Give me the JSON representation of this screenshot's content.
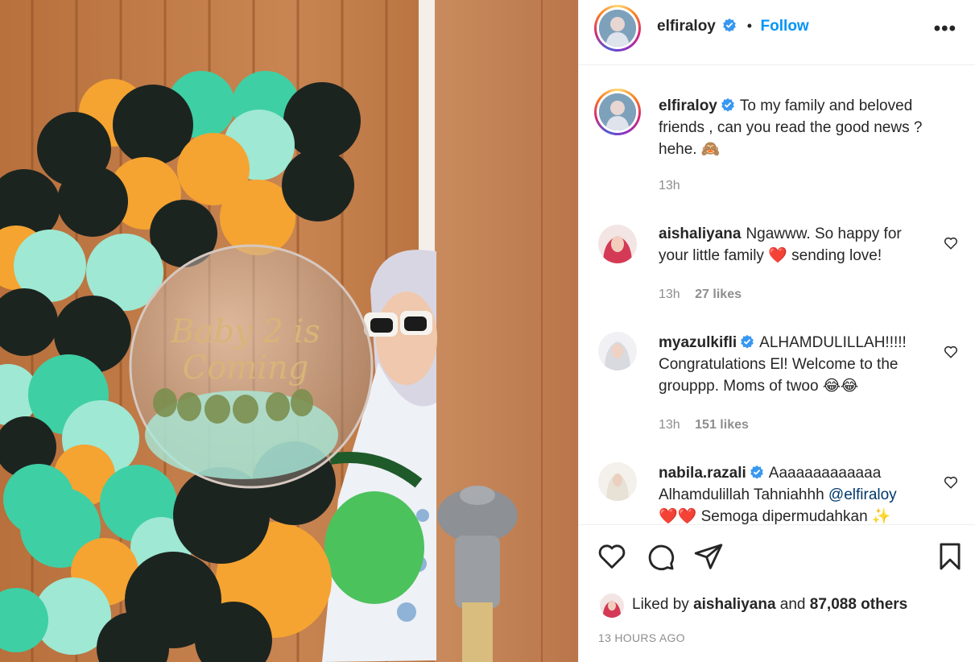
{
  "post": {
    "header": {
      "username": "elfiraloy",
      "follow_label": "Follow",
      "separator": "•",
      "more_label": "•••"
    },
    "caption": {
      "username": "elfiraloy",
      "text": "To my family and beloved friends , can you read the good news ? hehe.",
      "emoji": "🙈",
      "time": "13h"
    },
    "comments": [
      {
        "username": "aishaliyana",
        "text_before": "Ngawww. So happy for your little family",
        "emoji": "❤️",
        "text_after": "sending love!",
        "time": "13h",
        "likes": "27 likes"
      },
      {
        "username": "myazulkifli",
        "text": "ALHAMDULILLAH!!!!! Congratulations El! Welcome to the grouppp. Moms of twoo",
        "emoji": "😂😂",
        "time": "13h",
        "likes": "151 likes"
      },
      {
        "username": "nabila.razali",
        "text": "Aaaaaaaaaaaaa Alhamdulillah Tahniahhh",
        "mention": "@elfiraloy",
        "text_line3": "Semoga dipermudahkan",
        "emoji_line3_before": "❤️❤️",
        "emoji_line3_after": "✨"
      }
    ],
    "liked_by": {
      "prefix": "Liked by",
      "user": "aishaliyana",
      "and": "and",
      "count": "87,088 others"
    },
    "timestamp": "13 HOURS AGO",
    "image": {
      "balloon_text_1": "Baby 2 is",
      "balloon_text_2": "Coming"
    }
  },
  "icons": [
    "verified-badge-icon",
    "heart-icon",
    "comment-icon",
    "share-icon",
    "bookmark-icon",
    "more-options-icon"
  ],
  "colors": {
    "link": "#0095f6",
    "mention": "#00376b",
    "verified": "#3897f0",
    "text": "#262626",
    "muted": "#8e8e8e"
  }
}
